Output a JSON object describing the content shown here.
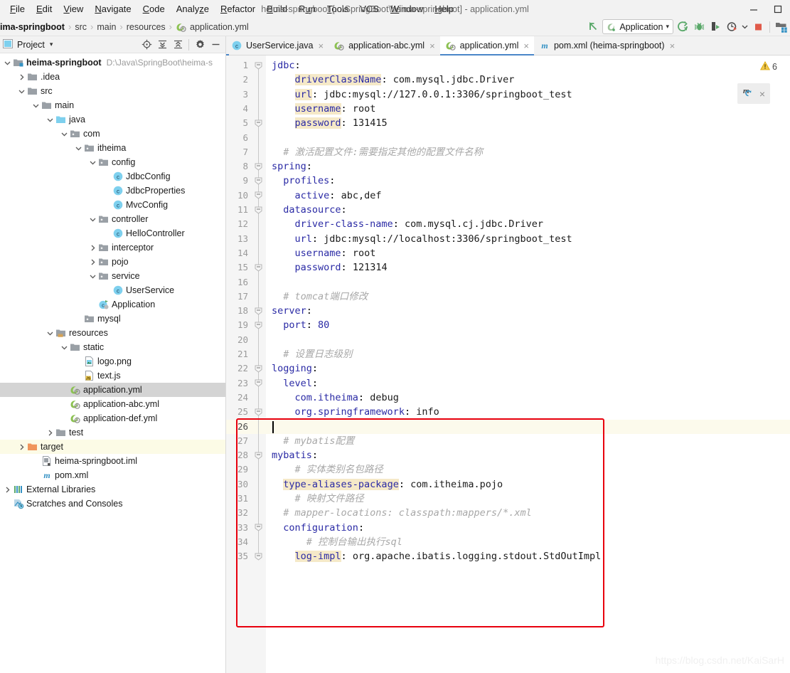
{
  "window": {
    "title": "heima-springboot [...\\SpringBoot\\heima-springboot] - application.yml",
    "minimize_label": "—",
    "maximize_label": "□"
  },
  "menubar": {
    "items": [
      "File",
      "Edit",
      "View",
      "Navigate",
      "Code",
      "Analyze",
      "Refactor",
      "Build",
      "Run",
      "Tools",
      "VCS",
      "Window",
      "Help"
    ]
  },
  "breadcrumb": {
    "items": [
      "ima-springboot",
      "src",
      "main",
      "resources",
      "application.yml"
    ],
    "separator": "›"
  },
  "toolbar": {
    "run_config_label": "Application",
    "dropdown_caret": "▾",
    "icons": [
      "build-icon",
      "run-icon",
      "debug-icon",
      "run-coverage-icon",
      "profiler-icon",
      "stop-icon",
      "project-structure-icon"
    ]
  },
  "project_panel": {
    "title": "Project",
    "dropdown_caret": "▾",
    "header_icons": [
      "locate-icon",
      "expand-all-icon",
      "collapse-all-icon",
      "settings-icon",
      "hide-icon"
    ],
    "tree": [
      {
        "depth": 0,
        "arrow": "down",
        "icon": "module-icon",
        "label": "heima-springboot",
        "bold": true,
        "path": "D:\\Java\\SpringBoot\\heima-s",
        "state": "normal"
      },
      {
        "depth": 1,
        "arrow": "right",
        "icon": "folder-icon",
        "label": ".idea",
        "state": "normal"
      },
      {
        "depth": 1,
        "arrow": "down",
        "icon": "folder-icon",
        "label": "src",
        "state": "normal"
      },
      {
        "depth": 2,
        "arrow": "down",
        "icon": "folder-icon",
        "label": "main",
        "state": "normal"
      },
      {
        "depth": 3,
        "arrow": "down",
        "icon": "source-root-icon",
        "label": "java",
        "state": "normal"
      },
      {
        "depth": 4,
        "arrow": "down",
        "icon": "package-icon",
        "label": "com",
        "state": "normal"
      },
      {
        "depth": 5,
        "arrow": "down",
        "icon": "package-icon",
        "label": "itheima",
        "state": "normal"
      },
      {
        "depth": 6,
        "arrow": "down",
        "icon": "package-icon",
        "label": "config",
        "state": "normal"
      },
      {
        "depth": 7,
        "arrow": "none",
        "icon": "class-icon",
        "label": "JdbcConfig",
        "state": "normal"
      },
      {
        "depth": 7,
        "arrow": "none",
        "icon": "class-icon",
        "label": "JdbcProperties",
        "state": "normal"
      },
      {
        "depth": 7,
        "arrow": "none",
        "icon": "class-icon",
        "label": "MvcConfig",
        "state": "normal"
      },
      {
        "depth": 6,
        "arrow": "down",
        "icon": "package-icon",
        "label": "controller",
        "state": "normal"
      },
      {
        "depth": 7,
        "arrow": "none",
        "icon": "class-icon",
        "label": "HelloController",
        "state": "normal"
      },
      {
        "depth": 6,
        "arrow": "right",
        "icon": "package-icon",
        "label": "interceptor",
        "state": "normal"
      },
      {
        "depth": 6,
        "arrow": "right",
        "icon": "package-icon",
        "label": "pojo",
        "state": "normal"
      },
      {
        "depth": 6,
        "arrow": "down",
        "icon": "package-icon",
        "label": "service",
        "state": "normal"
      },
      {
        "depth": 7,
        "arrow": "none",
        "icon": "class-icon",
        "label": "UserService",
        "state": "normal"
      },
      {
        "depth": 6,
        "arrow": "none",
        "icon": "spring-class-icon",
        "label": "Application",
        "state": "normal"
      },
      {
        "depth": 5,
        "arrow": "none",
        "icon": "package-icon",
        "label": "mysql",
        "state": "normal"
      },
      {
        "depth": 3,
        "arrow": "down",
        "icon": "resource-root-icon",
        "label": "resources",
        "state": "normal"
      },
      {
        "depth": 4,
        "arrow": "down",
        "icon": "folder-icon",
        "label": "static",
        "state": "normal"
      },
      {
        "depth": 5,
        "arrow": "none",
        "icon": "image-file-icon",
        "label": "logo.png",
        "state": "normal"
      },
      {
        "depth": 5,
        "arrow": "none",
        "icon": "js-file-icon",
        "label": "text.js",
        "state": "normal"
      },
      {
        "depth": 4,
        "arrow": "none",
        "icon": "yml-file-icon",
        "label": "application.yml",
        "state": "selected"
      },
      {
        "depth": 4,
        "arrow": "none",
        "icon": "yml-file-icon",
        "label": "application-abc.yml",
        "state": "normal"
      },
      {
        "depth": 4,
        "arrow": "none",
        "icon": "yml-file-icon",
        "label": "application-def.yml",
        "state": "normal"
      },
      {
        "depth": 3,
        "arrow": "right",
        "icon": "folder-icon",
        "label": "test",
        "state": "normal"
      },
      {
        "depth": 1,
        "arrow": "right",
        "icon": "target-folder-icon",
        "label": "target",
        "state": "target"
      },
      {
        "depth": 2,
        "arrow": "none",
        "icon": "iml-file-icon",
        "label": "heima-springboot.iml",
        "state": "normal"
      },
      {
        "depth": 2,
        "arrow": "none",
        "icon": "maven-file-icon",
        "label": "pom.xml",
        "state": "normal"
      },
      {
        "depth": 0,
        "arrow": "right",
        "icon": "libraries-icon",
        "label": "External Libraries",
        "state": "normal"
      },
      {
        "depth": 0,
        "arrow": "none",
        "icon": "scratches-icon",
        "label": "Scratches and Consoles",
        "state": "normal"
      }
    ]
  },
  "editor": {
    "tabs": [
      {
        "label": "UserService.java",
        "icon": "class-icon",
        "active": false,
        "close": "×"
      },
      {
        "label": "application-abc.yml",
        "icon": "yml-file-icon",
        "active": false,
        "close": "×"
      },
      {
        "label": "application.yml",
        "icon": "yml-file-icon",
        "active": true,
        "close": "×"
      },
      {
        "label": "pom.xml (heima-springboot)",
        "icon": "maven-file-icon",
        "active": false,
        "close": "×"
      }
    ],
    "warning_badge": {
      "icon": "warning-icon",
      "count": "6"
    },
    "maven_popup": {
      "icon": "maven-reload-icon",
      "close": "×"
    },
    "current_line": 26,
    "line_count": 35,
    "lines": [
      {
        "n": 1,
        "fold": "start-open",
        "tokens": [
          {
            "t": "jdbc",
            "c": "k"
          },
          {
            "t": ":",
            "c": "pn"
          }
        ]
      },
      {
        "n": 2,
        "fold": "none",
        "tokens": [
          {
            "t": "    ",
            "c": "v"
          },
          {
            "t": "driverClassName",
            "c": "khl"
          },
          {
            "t": ": ",
            "c": "pn"
          },
          {
            "t": "com.mysql.jdbc.Driver",
            "c": "v"
          }
        ]
      },
      {
        "n": 3,
        "fold": "none",
        "tokens": [
          {
            "t": "    ",
            "c": "v"
          },
          {
            "t": "url",
            "c": "khl"
          },
          {
            "t": ": ",
            "c": "pn"
          },
          {
            "t": "jdbc:mysql://127.0.0.1:3306/springboot_test",
            "c": "v"
          }
        ]
      },
      {
        "n": 4,
        "fold": "none",
        "tokens": [
          {
            "t": "    ",
            "c": "v"
          },
          {
            "t": "username",
            "c": "khl"
          },
          {
            "t": ": ",
            "c": "pn"
          },
          {
            "t": "root",
            "c": "v"
          }
        ]
      },
      {
        "n": 5,
        "fold": "end",
        "tokens": [
          {
            "t": "    ",
            "c": "v"
          },
          {
            "t": "password",
            "c": "khl"
          },
          {
            "t": ": ",
            "c": "pn"
          },
          {
            "t": "131415",
            "c": "v"
          }
        ]
      },
      {
        "n": 6,
        "fold": "none",
        "tokens": []
      },
      {
        "n": 7,
        "fold": "none",
        "tokens": [
          {
            "t": "  # 激活配置文件:需要指定其他的配置文件名称",
            "c": "cm"
          }
        ]
      },
      {
        "n": 8,
        "fold": "start-open",
        "tokens": [
          {
            "t": "spring",
            "c": "k"
          },
          {
            "t": ":",
            "c": "pn"
          }
        ]
      },
      {
        "n": 9,
        "fold": "start-open",
        "tokens": [
          {
            "t": "  ",
            "c": "v"
          },
          {
            "t": "profiles",
            "c": "k"
          },
          {
            "t": ":",
            "c": "pn"
          }
        ]
      },
      {
        "n": 10,
        "fold": "end",
        "tokens": [
          {
            "t": "    ",
            "c": "v"
          },
          {
            "t": "active",
            "c": "k"
          },
          {
            "t": ": ",
            "c": "pn"
          },
          {
            "t": "abc,def",
            "c": "v"
          }
        ]
      },
      {
        "n": 11,
        "fold": "start-open",
        "tokens": [
          {
            "t": "  ",
            "c": "v"
          },
          {
            "t": "datasource",
            "c": "k"
          },
          {
            "t": ":",
            "c": "pn"
          }
        ]
      },
      {
        "n": 12,
        "fold": "none",
        "tokens": [
          {
            "t": "    ",
            "c": "v"
          },
          {
            "t": "driver-class-name",
            "c": "k"
          },
          {
            "t": ": ",
            "c": "pn"
          },
          {
            "t": "com.mysql.cj.jdbc.Driver",
            "c": "v"
          }
        ]
      },
      {
        "n": 13,
        "fold": "none",
        "tokens": [
          {
            "t": "    ",
            "c": "v"
          },
          {
            "t": "url",
            "c": "k"
          },
          {
            "t": ": ",
            "c": "pn"
          },
          {
            "t": "jdbc:mysql://localhost:3306/springboot_test",
            "c": "v"
          }
        ]
      },
      {
        "n": 14,
        "fold": "none",
        "tokens": [
          {
            "t": "    ",
            "c": "v"
          },
          {
            "t": "username",
            "c": "k"
          },
          {
            "t": ": ",
            "c": "pn"
          },
          {
            "t": "root",
            "c": "v"
          }
        ]
      },
      {
        "n": 15,
        "fold": "end",
        "tokens": [
          {
            "t": "    ",
            "c": "v"
          },
          {
            "t": "password",
            "c": "k"
          },
          {
            "t": ": ",
            "c": "pn"
          },
          {
            "t": "121314",
            "c": "v"
          }
        ]
      },
      {
        "n": 16,
        "fold": "none",
        "tokens": []
      },
      {
        "n": 17,
        "fold": "none",
        "tokens": [
          {
            "t": "  # tomcat端口修改",
            "c": "cm"
          }
        ]
      },
      {
        "n": 18,
        "fold": "start-open",
        "tokens": [
          {
            "t": "server",
            "c": "k"
          },
          {
            "t": ":",
            "c": "pn"
          }
        ]
      },
      {
        "n": 19,
        "fold": "end",
        "tokens": [
          {
            "t": "  ",
            "c": "v"
          },
          {
            "t": "port",
            "c": "k"
          },
          {
            "t": ": ",
            "c": "pn"
          },
          {
            "t": "80",
            "c": "num"
          }
        ]
      },
      {
        "n": 20,
        "fold": "none",
        "tokens": []
      },
      {
        "n": 21,
        "fold": "none",
        "tokens": [
          {
            "t": "  # 设置日志级别",
            "c": "cm"
          }
        ]
      },
      {
        "n": 22,
        "fold": "start-open",
        "tokens": [
          {
            "t": "logging",
            "c": "k"
          },
          {
            "t": ":",
            "c": "pn"
          }
        ]
      },
      {
        "n": 23,
        "fold": "start-open",
        "tokens": [
          {
            "t": "  ",
            "c": "v"
          },
          {
            "t": "level",
            "c": "k"
          },
          {
            "t": ":",
            "c": "pn"
          }
        ]
      },
      {
        "n": 24,
        "fold": "none",
        "tokens": [
          {
            "t": "    ",
            "c": "v"
          },
          {
            "t": "com.itheima",
            "c": "k"
          },
          {
            "t": ": ",
            "c": "pn"
          },
          {
            "t": "debug",
            "c": "v"
          }
        ]
      },
      {
        "n": 25,
        "fold": "end",
        "tokens": [
          {
            "t": "    ",
            "c": "v"
          },
          {
            "t": "org.springframework",
            "c": "k"
          },
          {
            "t": ": ",
            "c": "pn"
          },
          {
            "t": "info",
            "c": "v"
          }
        ]
      },
      {
        "n": 26,
        "fold": "none",
        "tokens": []
      },
      {
        "n": 27,
        "fold": "none",
        "tokens": [
          {
            "t": "  # mybatis配置",
            "c": "cm"
          }
        ]
      },
      {
        "n": 28,
        "fold": "start-open",
        "tokens": [
          {
            "t": "mybatis",
            "c": "k"
          },
          {
            "t": ":",
            "c": "pn"
          }
        ]
      },
      {
        "n": 29,
        "fold": "none",
        "tokens": [
          {
            "t": "    # 实体类别名包路径",
            "c": "cm"
          }
        ]
      },
      {
        "n": 30,
        "fold": "none",
        "tokens": [
          {
            "t": "  ",
            "c": "v"
          },
          {
            "t": "type-aliases-package",
            "c": "khl"
          },
          {
            "t": ": ",
            "c": "pn"
          },
          {
            "t": "com.itheima.pojo",
            "c": "v"
          }
        ]
      },
      {
        "n": 31,
        "fold": "none",
        "tokens": [
          {
            "t": "    # 映射文件路径",
            "c": "cm"
          }
        ]
      },
      {
        "n": 32,
        "fold": "none",
        "tokens": [
          {
            "t": "  # mapper-locations: classpath:mappers/*.xml",
            "c": "cm"
          }
        ]
      },
      {
        "n": 33,
        "fold": "start-open",
        "tokens": [
          {
            "t": "  ",
            "c": "v"
          },
          {
            "t": "configuration",
            "c": "k"
          },
          {
            "t": ":",
            "c": "pn"
          }
        ]
      },
      {
        "n": 34,
        "fold": "none",
        "tokens": [
          {
            "t": "      # 控制台输出执行sql",
            "c": "cm"
          }
        ]
      },
      {
        "n": 35,
        "fold": "end",
        "tokens": [
          {
            "t": "    ",
            "c": "v"
          },
          {
            "t": "log-impl",
            "c": "khl"
          },
          {
            "t": ": ",
            "c": "pn"
          },
          {
            "t": "org.apache.ibatis.logging.stdout.StdOutImpl",
            "c": "v"
          }
        ]
      }
    ]
  },
  "watermark": {
    "text": "https://blog.csdn.net/KaiSarH"
  },
  "colors": {
    "key": "#2a2aa5",
    "key_highlight_bg": "#f5e9c8",
    "comment": "#a8a8a8",
    "current_line_bg": "#fcfaec",
    "selection_bg": "#d4d4d4",
    "red_box": "#e8000d",
    "tab_active_underline": "#4a86c8",
    "chrome_bg": "#f2f2f2"
  }
}
